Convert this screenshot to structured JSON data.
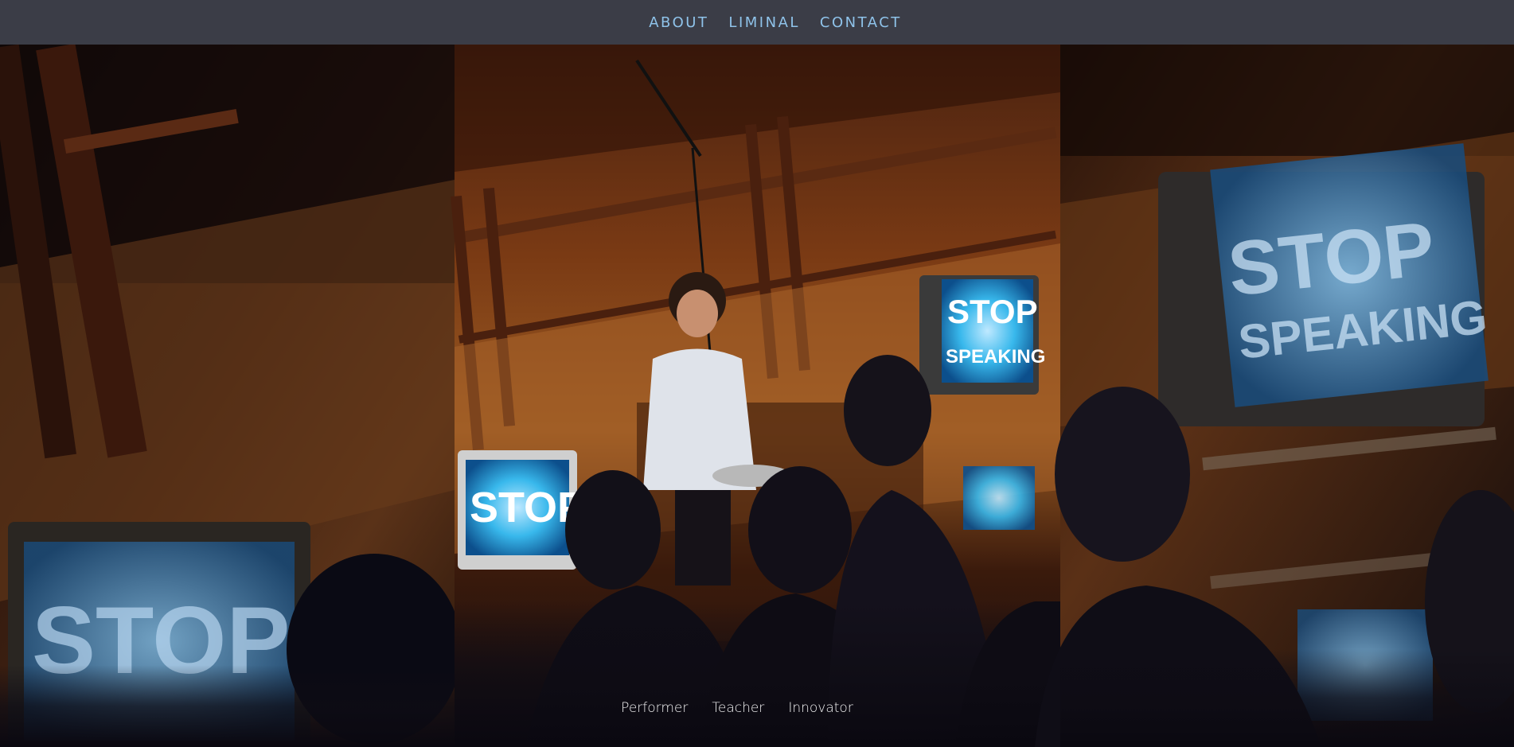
{
  "nav": {
    "items": [
      {
        "label": "ABOUT"
      },
      {
        "label": "LIMINAL"
      },
      {
        "label": "CONTACT"
      }
    ]
  },
  "hero": {
    "screen_text_line1": "STOP",
    "screen_text_line2": "SPEAKING",
    "taglines": [
      "Performer",
      "Teacher",
      "Innovator"
    ]
  },
  "colors": {
    "nav_bg": "#3b3d47",
    "nav_link": "#8fc3ea",
    "tagline": "#ffffff",
    "wood": "#7a3a14",
    "screen_glow": "#2fb4e8"
  }
}
